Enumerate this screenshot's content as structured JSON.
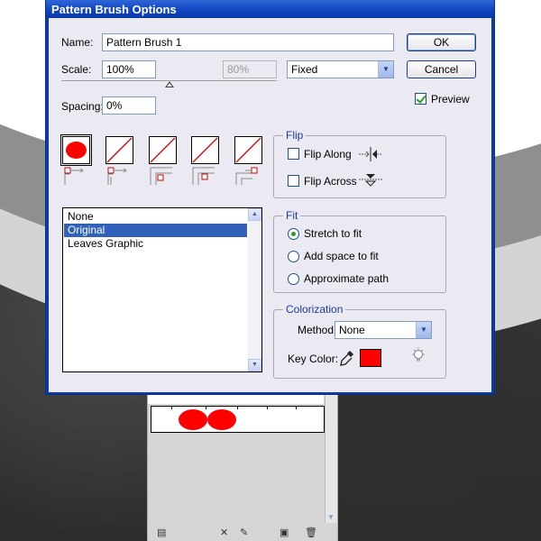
{
  "dialog": {
    "title": "Pattern Brush Options",
    "name_label": "Name:",
    "name_value": "Pattern Brush 1",
    "ok_label": "OK",
    "cancel_label": "Cancel",
    "preview_label": "Preview",
    "preview_checked": true,
    "scale_label": "Scale:",
    "scale_value": "100%",
    "scale_secondary": "80%",
    "scale_mode": "Fixed",
    "spacing_label": "Spacing:",
    "spacing_value": "0%",
    "tiles": [
      {
        "name": "side-tile",
        "selected": true
      },
      {
        "name": "outer-corner-tile",
        "selected": false
      },
      {
        "name": "inner-corner-tile",
        "selected": false
      },
      {
        "name": "start-tile",
        "selected": false
      },
      {
        "name": "end-tile",
        "selected": false
      }
    ],
    "tile_list": [
      "None",
      "Original",
      "Leaves Graphic"
    ],
    "tile_list_selected": "Original",
    "flip": {
      "title": "Flip",
      "along_label": "Flip Along",
      "across_label": "Flip Across"
    },
    "fit": {
      "title": "Fit",
      "options": [
        "Stretch to fit",
        "Add space to fit",
        "Approximate path"
      ],
      "selected": "Stretch to fit"
    },
    "colorization": {
      "title": "Colorization",
      "method_label": "Method:",
      "method_value": "None",
      "key_color_label": "Key Color:",
      "key_color": "#ff0000"
    }
  },
  "colors": {
    "title_bar": "#1248c4",
    "dialog_bg": "#ebeaf2",
    "selection": "#3161b8",
    "accent_red": "#ff0000"
  },
  "icons": [
    "eyedropper-icon",
    "lightbulb-icon",
    "flip-along-icon",
    "flip-across-icon"
  ]
}
